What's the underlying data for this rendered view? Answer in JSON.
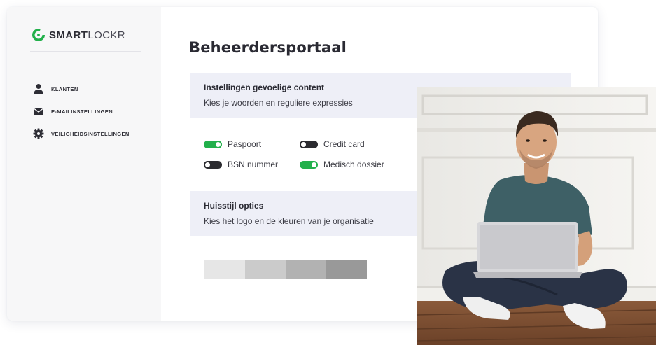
{
  "brand": {
    "name_bold": "SMART",
    "name_light": "LOCKR"
  },
  "sidebar": {
    "items": [
      {
        "label": "KLANTEN",
        "icon": "user-icon"
      },
      {
        "label": "E-MAILINSTELLINGEN",
        "icon": "email-icon"
      },
      {
        "label": "VEILIGHEIDSINSTELLINGEN",
        "icon": "gear-icon"
      }
    ]
  },
  "main": {
    "title": "Beheerdersportaal",
    "sensitive": {
      "title": "Instellingen gevoelige content",
      "subtitle": "Kies je woorden en reguliere expressies",
      "toggles": [
        {
          "label": "Paspoort",
          "on": true
        },
        {
          "label": "Credit card",
          "on": false
        },
        {
          "label": "BSN nummer",
          "on": false
        },
        {
          "label": "Medisch dossier",
          "on": true
        }
      ]
    },
    "branding": {
      "title": "Huisstijl opties",
      "subtitle": "Kies het logo en de kleuren van je organisatie",
      "swatches": [
        "#e6e6e6",
        "#cbcbcb",
        "#b2b2b2",
        "#999999"
      ]
    }
  },
  "colors": {
    "accent_green": "#22b04b",
    "section_bg": "#eeeff7",
    "sidebar_bg": "#f7f7f8"
  },
  "photo": {
    "subject": "man-sitting-with-laptop"
  }
}
